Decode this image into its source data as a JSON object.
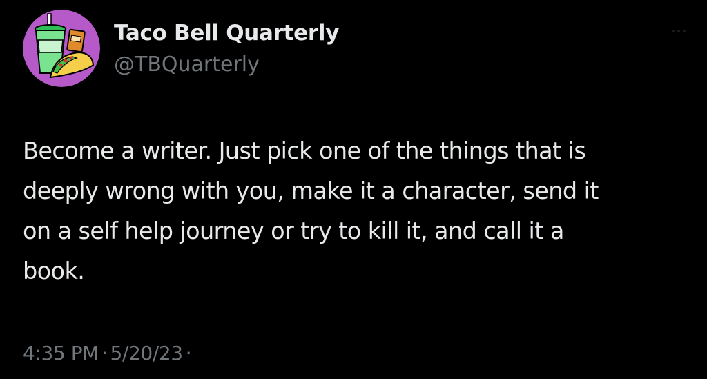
{
  "author": {
    "display_name": "Taco Bell Quarterly",
    "handle": "@TBQuarterly",
    "avatar_icon": "taco-bell-drink-and-taco-icon"
  },
  "tweet": {
    "text_lines": [
      "Become a writer. Just pick one of the things that is",
      "deeply wrong with you, make it a character, send it",
      "on a self help journey or try to kill it, and call it a",
      "book."
    ]
  },
  "meta": {
    "time": "4:35 PM",
    "separator": "·",
    "date": "5/20/23"
  },
  "colors": {
    "background": "#000000",
    "primary_text": "#e7e9ea",
    "secondary_text": "#71767b",
    "avatar_background": "#b659c9"
  }
}
